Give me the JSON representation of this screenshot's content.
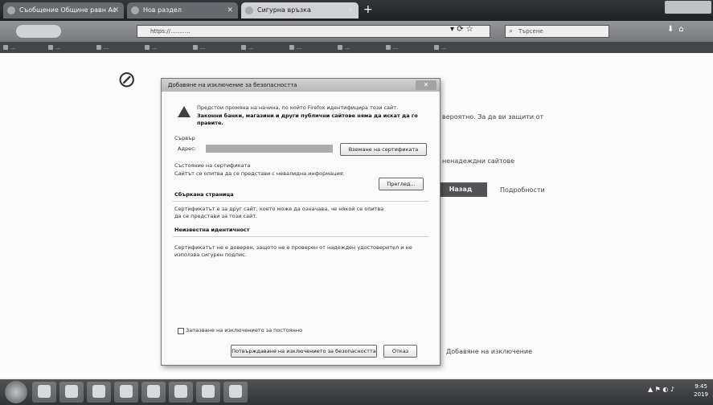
{
  "browser": {
    "tabs": [
      {
        "label": "Съобщение Общинe равн Ас",
        "close": "✕"
      },
      {
        "label": "Нов раздел",
        "close": "✕"
      },
      {
        "label": "Сигурна връзка",
        "close": "✕"
      }
    ],
    "newtab": "+",
    "url": "https://...........",
    "search_placeholder": "Търсене",
    "bookmarks": [
      "...",
      "...",
      "...",
      "...",
      "...",
      "...",
      "...",
      "...",
      "...",
      "..."
    ]
  },
  "page": {
    "text_right1": "вероятно. За да ви защити от",
    "text_right2": "ненадеждни сайтове",
    "back_button": "Назад",
    "details_link": "Подробности",
    "exception_link": "Добавяне на изключение"
  },
  "dialog": {
    "title": "Добавяне на изключение за безопасността",
    "warning_line1": "Предстои промяна на начина, по който Firefox идентифицира този сайт.",
    "warning_line2": "Законни банки, магазини и други публични сайтове няма да искат да го",
    "warning_line3": "правите.",
    "server_label": "Сървър",
    "address_label": "Адрес:",
    "get_cert_button": "Вземане на сертификата",
    "cert_status_label": "Състояние на сертификата",
    "cert_status_text": "Сайтът се опитва да се представи с невалидна информация.",
    "view_button": "Преглед...",
    "wrong_site_heading": "Сбъркана страница",
    "wrong_site_line1": "Сертификатът е за друг сайт, което може да означава, че някой се опитва",
    "wrong_site_line2": "да се представи за този сайт.",
    "unknown_identity_heading": "Неизвестна идентичност",
    "unknown_identity_line1": "Сертификатът не е доверен, защото не е проверен от надежден удостоверител и не",
    "unknown_identity_line2": "използва сигурен подпис.",
    "permanent_label": "Запазване на изключението за постоянно",
    "confirm_button": "Потвърждаване на изключението за безопасността",
    "cancel_button": "Отказ"
  },
  "taskbar": {
    "tray": "▲ ⚑ ◐ ♪",
    "time": "9:45",
    "date": "2019"
  }
}
